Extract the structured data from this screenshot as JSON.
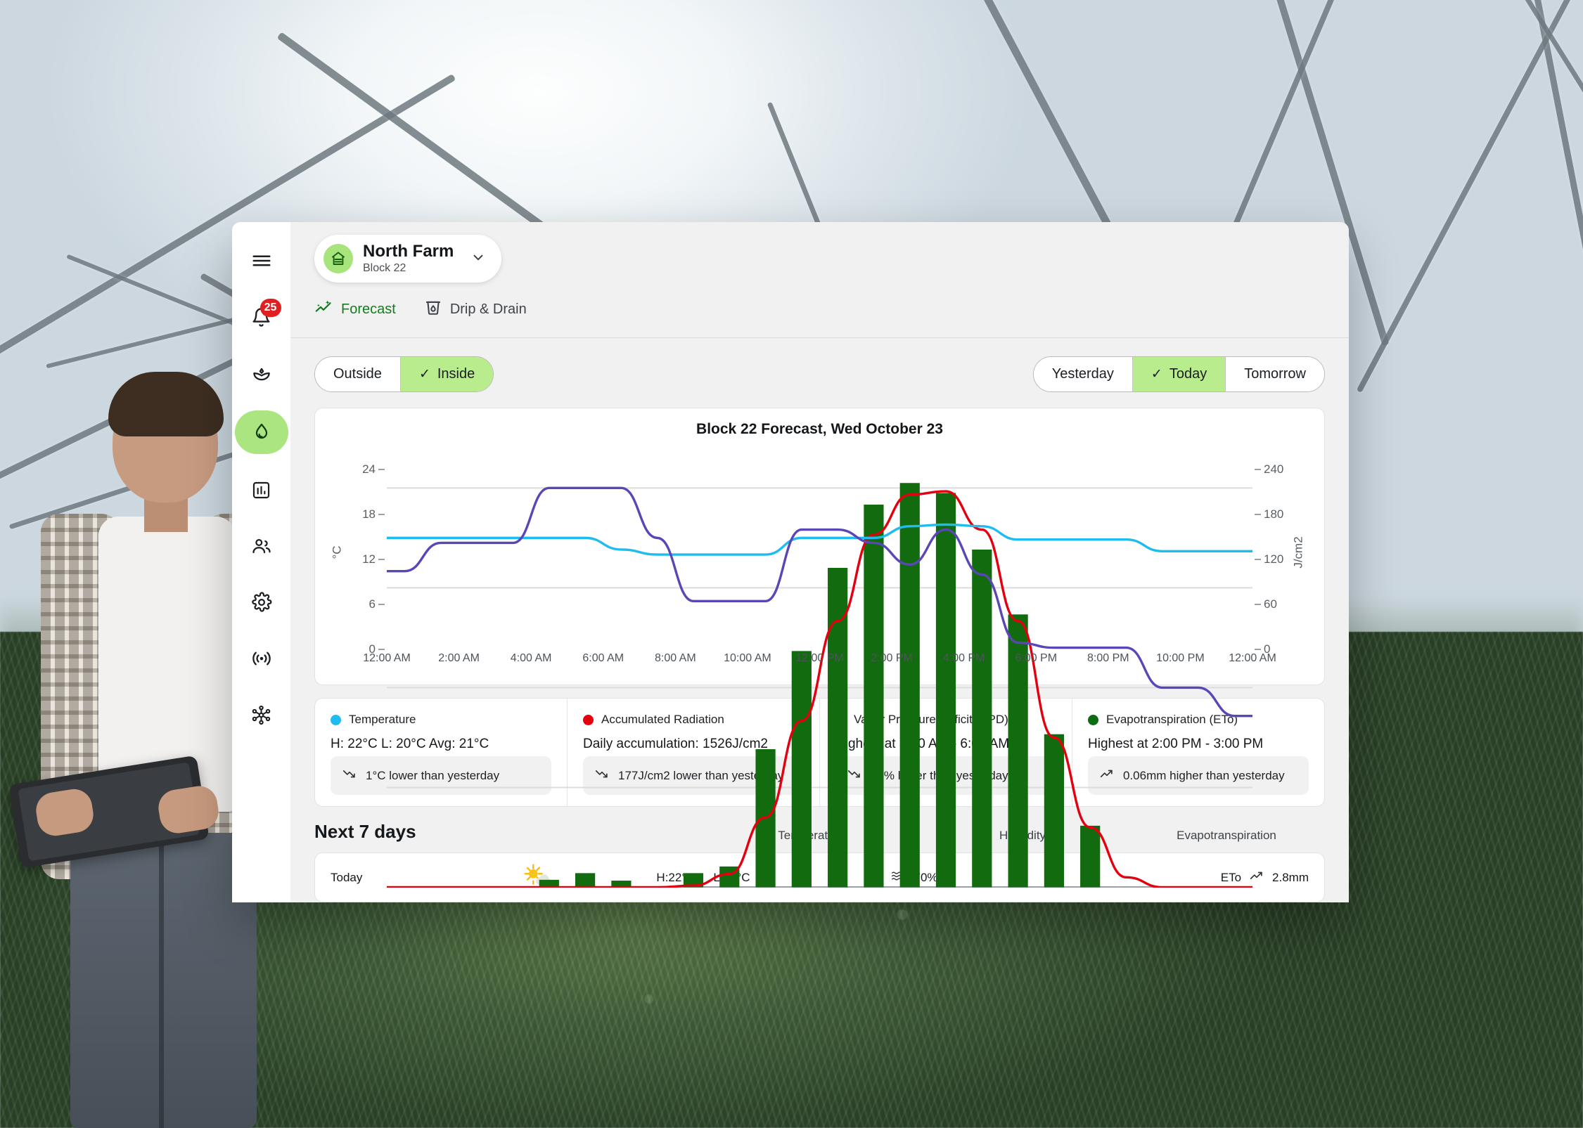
{
  "sidebar": {
    "items": [
      {
        "name": "menu",
        "icon": "hamburger-icon"
      },
      {
        "name": "notifications",
        "icon": "bell-icon",
        "badge": "25"
      },
      {
        "name": "crops",
        "icon": "plant-icon"
      },
      {
        "name": "irrigation",
        "icon": "water-drop-icon",
        "active": true
      },
      {
        "name": "analytics",
        "icon": "bar-chart-icon"
      },
      {
        "name": "team",
        "icon": "people-icon"
      },
      {
        "name": "settings",
        "icon": "gear-icon"
      },
      {
        "name": "sensors",
        "icon": "broadcast-icon"
      },
      {
        "name": "network",
        "icon": "nodes-icon"
      }
    ]
  },
  "header": {
    "farm_name": "North Farm",
    "block": "Block 22",
    "chevron": "chevron-down-icon"
  },
  "tabs": [
    {
      "label": "Forecast",
      "icon": "trend-sparkle-icon",
      "selected": true
    },
    {
      "label": "Drip & Drain",
      "icon": "drip-cup-icon",
      "selected": false
    }
  ],
  "location_toggle": {
    "options": [
      {
        "label": "Outside",
        "selected": false
      },
      {
        "label": "Inside",
        "selected": true
      }
    ],
    "check": "✓"
  },
  "day_toggle": {
    "options": [
      {
        "label": "Yesterday",
        "selected": false
      },
      {
        "label": "Today",
        "selected": true
      },
      {
        "label": "Tomorrow",
        "selected": false
      }
    ],
    "check": "✓"
  },
  "chart_data": {
    "type": "bar",
    "title": "Block 22 Forecast, Wed October 23",
    "xlabel": "",
    "ylabel": "°C",
    "ylabel_right": "J/cm2",
    "ylim": [
      0,
      26
    ],
    "ylim_right": [
      0,
      260
    ],
    "yticks": [
      0,
      6,
      12,
      18,
      24
    ],
    "yticks_right": [
      0,
      60,
      120,
      180,
      240
    ],
    "grid": true,
    "legend_position": "below-chart",
    "x_ticklabels": [
      "12:00 AM",
      "2:00 AM",
      "4:00 AM",
      "6:00 AM",
      "8:00 AM",
      "10:00 AM",
      "12:00 PM",
      "2:00 PM",
      "4:00 PM",
      "6:00 PM",
      "8:00 PM",
      "10:00 PM",
      "12:00 AM"
    ],
    "hours": [
      0,
      1,
      2,
      3,
      4,
      5,
      6,
      7,
      8,
      9,
      10,
      11,
      12,
      13,
      14,
      15,
      16,
      17,
      18,
      19,
      20,
      21,
      22,
      23
    ],
    "series": [
      {
        "name": "Evapotranspiration (ETo)",
        "type": "bar",
        "color": "#136b10",
        "axis": "left",
        "values": [
          0,
          0,
          0,
          0,
          0.45,
          0.85,
          0.4,
          0,
          0.85,
          1.25,
          8.3,
          14.2,
          19.2,
          23.0,
          24.3,
          23.7,
          20.3,
          16.4,
          9.2,
          3.7,
          0,
          0,
          0,
          0
        ]
      },
      {
        "name": "Accumulated Radiation",
        "type": "line",
        "color": "#e3000f",
        "axis": "right",
        "values": [
          0,
          0,
          0,
          0,
          0,
          0,
          0,
          0,
          1,
          8,
          42,
          100,
          160,
          212,
          236,
          238,
          215,
          160,
          90,
          36,
          6,
          0,
          0,
          0
        ]
      },
      {
        "name": "Temperature",
        "type": "line",
        "color": "#1fbcf0",
        "axis": "left",
        "values": [
          21,
          21,
          21,
          21,
          21,
          21,
          20.3,
          20,
          20,
          20,
          20,
          21,
          21,
          21,
          21.7,
          21.8,
          21.7,
          20.9,
          20.9,
          20.9,
          20.9,
          20.2,
          20.2,
          20.2
        ]
      },
      {
        "name": "Vapor Pressure Deficit (VPD)",
        "type": "line",
        "color": "#5a46b6",
        "axis": "right",
        "values": [
          190,
          207,
          207,
          207,
          240,
          240,
          240,
          210,
          172,
          172,
          172,
          215,
          215,
          207,
          194,
          215,
          188,
          147,
          144,
          144,
          144,
          120,
          120,
          103
        ]
      }
    ]
  },
  "legend_cards": [
    {
      "name": "Temperature",
      "color": "#1fbcf0",
      "detail": "H: 22°C L: 20°C Avg: 21°C",
      "chip": "1°C lower than yesterday",
      "trend": "down"
    },
    {
      "name": "Accumulated Radiation",
      "color": "#e3000f",
      "detail": "Daily accumulation: 1526J/cm2",
      "chip": "177J/cm2 lower than yesterday",
      "trend": "down"
    },
    {
      "name": "Vapor Pressure Deficit (VPD)",
      "color": "#6d3fc4",
      "detail": "Highest at 3:00 AM - 6:00 AM",
      "chip": "53% lower than yesterday",
      "trend": "down"
    },
    {
      "name": "Evapotranspiration (ETo)",
      "color": "#0d6b12",
      "detail": "Highest at 2:00 PM - 3:00 PM",
      "chip": "0.06mm higher than yesterday",
      "trend": "up"
    }
  ],
  "next7": {
    "title": "Next 7 days",
    "columns": [
      "Temperature",
      "Humidity",
      "Evapotranspiration"
    ],
    "rows": [
      {
        "day": "Today",
        "weather_icon": "sun-behind-cloud-icon",
        "high": "H:22°C",
        "low": "L:20°C",
        "humidity_icon": "humidity-waves-icon",
        "humidity": "70%",
        "eto_label": "ETo",
        "eto_icon": "trend-up-icon",
        "eto": "2.8mm"
      }
    ]
  },
  "colors": {
    "accent_green": "#127d1e",
    "pill_green": "#aae57f",
    "seg_green": "#b9ec8c",
    "badge_red": "#e02020"
  }
}
